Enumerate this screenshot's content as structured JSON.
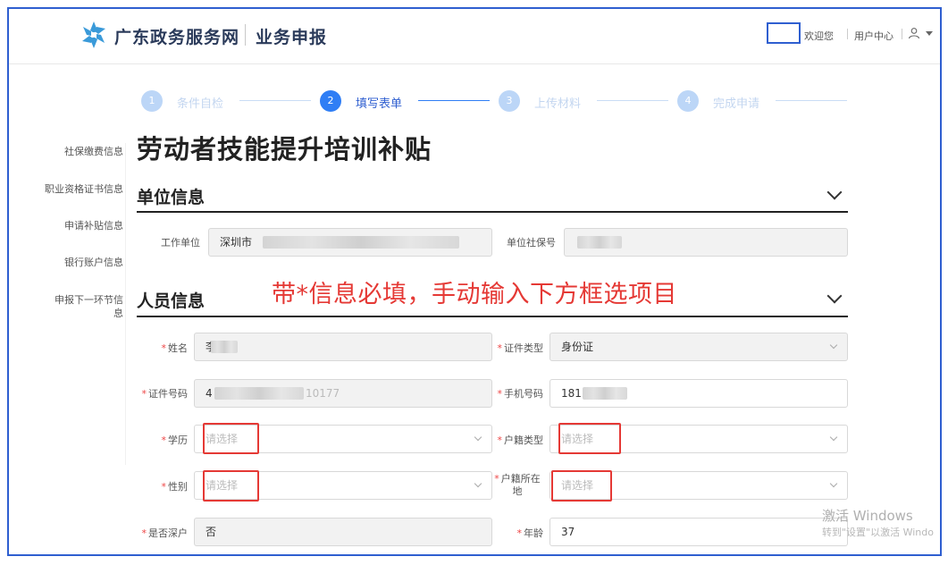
{
  "header": {
    "site_name": "广东政务服务网",
    "section_name": "业务申报",
    "welcome": "欢迎您",
    "user_center": "用户中心"
  },
  "steps": [
    {
      "num": "1",
      "label": "条件自检",
      "active": false
    },
    {
      "num": "2",
      "label": "填写表单",
      "active": true
    },
    {
      "num": "3",
      "label": "上传材料",
      "active": false
    },
    {
      "num": "4",
      "label": "完成申请",
      "active": false
    }
  ],
  "sidenav": [
    "社保缴费信息",
    "职业资格证书信息",
    "申请补贴信息",
    "银行账户信息",
    "申报下一环节信息"
  ],
  "page_title": "劳动者技能提升培训补贴",
  "unit_section": {
    "title": "单位信息",
    "work_unit_label": "工作单位",
    "work_unit_value": "深圳市",
    "unit_social_no_label": "单位社保号"
  },
  "person_section": {
    "title": "人员信息",
    "annotation": "带*信息必填，手动输入下方框选项目",
    "name_label": "姓名",
    "name_value": "李",
    "id_type_label": "证件类型",
    "id_type_value": "身份证",
    "id_no_label": "证件号码",
    "id_no_value": "4",
    "id_no_tail": "10177",
    "phone_label": "手机号码",
    "phone_value": "181",
    "education_label": "学历",
    "household_type_label": "户籍类型",
    "gender_label": "性别",
    "household_loc_label": "户籍所在地",
    "select_placeholder": "请选择",
    "sz_household_label": "是否深户",
    "sz_household_value": "否",
    "age_label": "年龄",
    "age_value": "37"
  },
  "watermark": {
    "line1": "激活 Windows",
    "line2": "转到\"设置\"以激活 Windo"
  },
  "colors": {
    "accent": "#2f7ef5",
    "annotation_red": "#e53935",
    "frame_blue": "#2f5fd0"
  }
}
